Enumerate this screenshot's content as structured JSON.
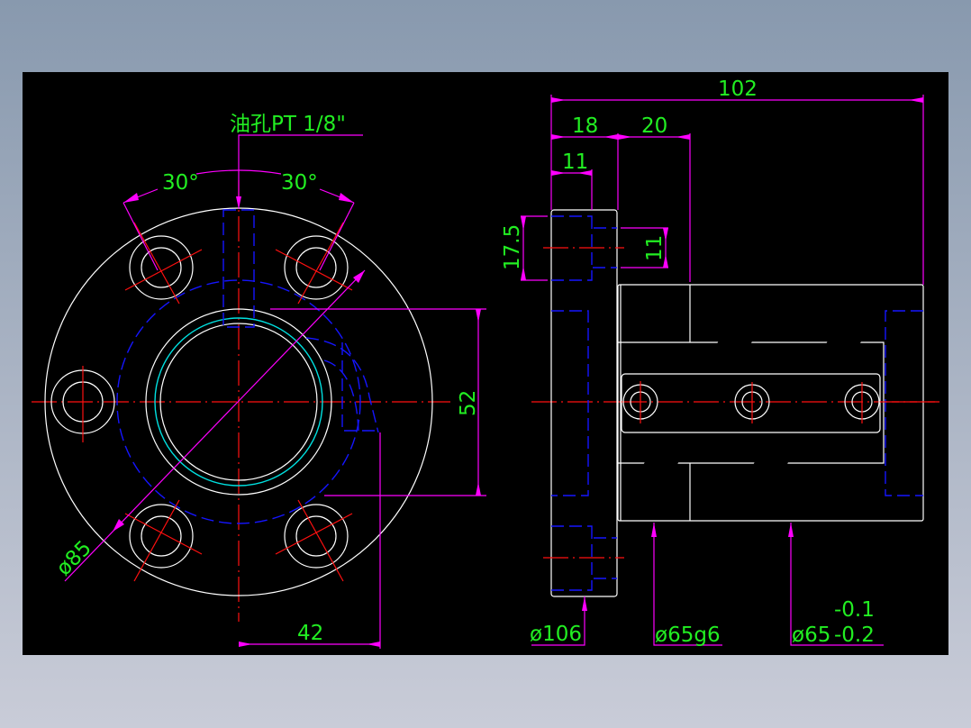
{
  "colors": {
    "background": "#000000",
    "outline": "#ffffff",
    "hidden": "#1515ff",
    "center": "#ff1010",
    "dimension": "#ff00ff",
    "text": "#22ee22",
    "thread": "#00e0e0"
  },
  "front_view": {
    "oil_hole_note": "油孔PT 1/8\"",
    "angle_left": "30°",
    "angle_right": "30°",
    "dim_height": "52",
    "dim_offset": "42",
    "dim_pcd": "ø85"
  },
  "side_view": {
    "dim_total_length": "102",
    "dim_flange": "18",
    "dim_step": "20",
    "dim_hole_depth": "11",
    "dim_counterbore": "17.5",
    "dim_hole": "11",
    "dia_flange": "ø106",
    "dia_fit": "ø65g6",
    "dia_body": "ø65",
    "tol_upper": "-0.1",
    "tol_lower": "-0.2"
  }
}
